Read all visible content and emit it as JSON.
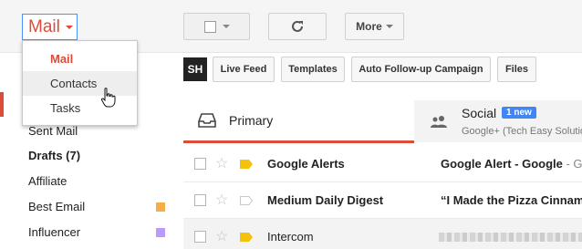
{
  "app_switcher": {
    "label": "Mail"
  },
  "dropdown": {
    "items": [
      {
        "label": "Mail",
        "selected": true
      },
      {
        "label": "Contacts",
        "hovered": true
      },
      {
        "label": "Tasks"
      }
    ]
  },
  "toolbar": {
    "select_icon": "checkbox-icon",
    "refresh_icon": "refresh-icon",
    "more_label": "More"
  },
  "sidebar": {
    "items": [
      {
        "label": "Sent Mail"
      },
      {
        "label": "Drafts (7)",
        "bold": true
      },
      {
        "label": "Affiliate"
      },
      {
        "label": "Best Email",
        "color": "#f6ae4a"
      },
      {
        "label": "Influencer",
        "color": "#b99aff"
      }
    ]
  },
  "extension": {
    "logo": "SH",
    "buttons": [
      "Live Feed",
      "Templates",
      "Auto Follow-up Campaign",
      "Files"
    ]
  },
  "tabs": {
    "primary": {
      "label": "Primary",
      "icon": "inbox-icon"
    },
    "social": {
      "label": "Social",
      "badge": "1 new",
      "sub": "Google+ (Tech Easy Solutio",
      "icon": "people-icon"
    }
  },
  "emails": [
    {
      "sender": "Google Alerts",
      "subject": "Google Alert - Google",
      "snippet": " - G",
      "unread": true,
      "important": true
    },
    {
      "sender": "Medium Daily Digest",
      "subject": "“I Made the Pizza Cinnam",
      "snippet": "",
      "unread": true,
      "important": false
    },
    {
      "sender": "Intercom",
      "subject": "",
      "snippet": "",
      "unread": false,
      "important": true
    }
  ],
  "colors": {
    "accent": "#dd4b39",
    "badge": "#4285f4",
    "important": "#f4c20d"
  }
}
